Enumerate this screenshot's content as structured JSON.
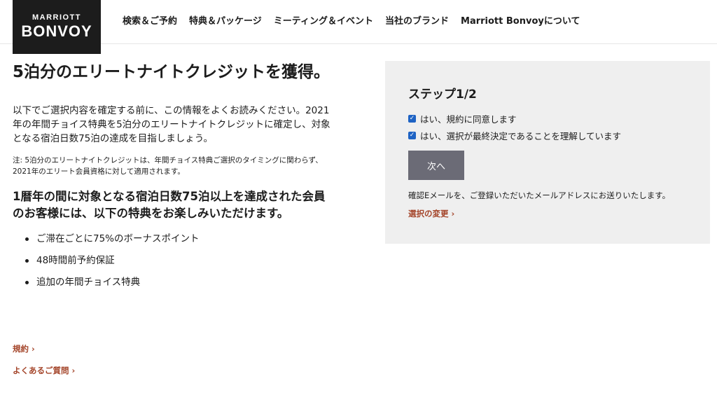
{
  "brand": {
    "top": "MARRIOTT",
    "main": "BONVOY"
  },
  "nav": [
    "検索＆ご予約",
    "特典＆パッケージ",
    "ミーティング＆イベント",
    "当社のブランド",
    "Marriott Bonvoyについて"
  ],
  "left": {
    "title": "5泊分のエリートナイトクレジットを獲得。",
    "intro": "以下でご選択内容を確定する前に、この情報をよくお読みください。2021年の年間チョイス特典を5泊分のエリートナイトクレジットに確定し、対象となる宿泊日数75泊の達成を目指しましょう。",
    "note": "注: 5泊分のエリートナイトクレジットは、年間チョイス特典ご選択のタイミングに関わらず、2021年のエリート会員資格に対して適用されます。",
    "subtitle": "1暦年の間に対象となる宿泊日数75泊以上を達成された会員のお客様には、以下の特典をお楽しみいただけます。",
    "benefits": [
      "ご滞在ごとに75%のボーナスポイント",
      "48時間前予約保証",
      "追加の年間チョイス特典"
    ],
    "link_terms": "規約",
    "link_faq": "よくあるご質問"
  },
  "panel": {
    "step": "ステップ1/2",
    "check1": "はい、規約に同意します",
    "check2": "はい、選択が最終決定であることを理解しています",
    "next": "次へ",
    "confirm": "確認Eメールを、ご登録いただいたメールアドレスにお送りいたします。",
    "change": "選択の変更"
  }
}
